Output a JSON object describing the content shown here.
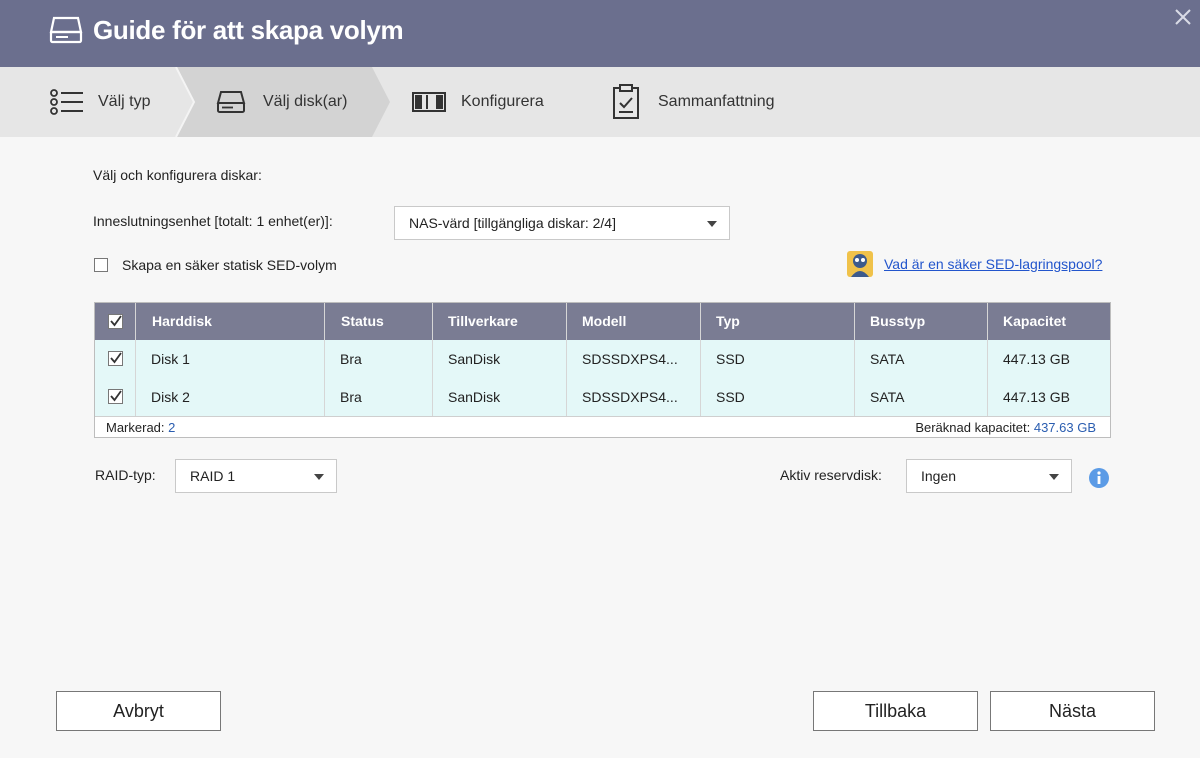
{
  "window": {
    "title": "Guide för att skapa volym"
  },
  "steps": [
    {
      "label": "Välj typ",
      "icon": "list-icon"
    },
    {
      "label": "Välj disk(ar)",
      "icon": "drive-icon",
      "active": true
    },
    {
      "label": "Konfigurera",
      "icon": "configure-icon"
    },
    {
      "label": "Sammanfattning",
      "icon": "clipboard-icon"
    }
  ],
  "content": {
    "heading": "Välj och konfigurera diskar:",
    "enclosure_label": "Inneslutningsenhet [totalt: 1 enhet(er)]:",
    "enclosure_value": "NAS-värd [tillgängliga diskar: 2/4]",
    "sed_checkbox_label": "Skapa en säker statisk SED-volym",
    "sed_checked": false,
    "help_link": "Vad är en säker SED-lagringspool?"
  },
  "table": {
    "columns": [
      "Harddisk",
      "Status",
      "Tillverkare",
      "Modell",
      "Typ",
      "Busstyp",
      "Kapacitet"
    ],
    "rows": [
      {
        "checked": true,
        "disk": "Disk 1",
        "status": "Bra",
        "vendor": "SanDisk",
        "model": "SDSSDXPS4...",
        "type": "SSD",
        "bus": "SATA",
        "capacity": "447.13 GB"
      },
      {
        "checked": true,
        "disk": "Disk 2",
        "status": "Bra",
        "vendor": "SanDisk",
        "model": "SDSSDXPS4...",
        "type": "SSD",
        "bus": "SATA",
        "capacity": "447.13 GB"
      }
    ],
    "footer": {
      "selected_label": "Markerad:",
      "selected_count": "2",
      "capacity_label": "Beräknad kapacitet:",
      "capacity_value": "437.63 GB"
    }
  },
  "raid": {
    "label": "RAID-typ:",
    "value": "RAID 1"
  },
  "spare": {
    "label": "Aktiv reservdisk:",
    "value": "Ingen"
  },
  "buttons": {
    "cancel": "Avbryt",
    "back": "Tillbaka",
    "next": "Nästa"
  },
  "colors": {
    "titlebar": "#6b6f8e",
    "table_header": "#7a7c93",
    "row_highlight": "#e4f8f8",
    "link": "#2255cc"
  }
}
